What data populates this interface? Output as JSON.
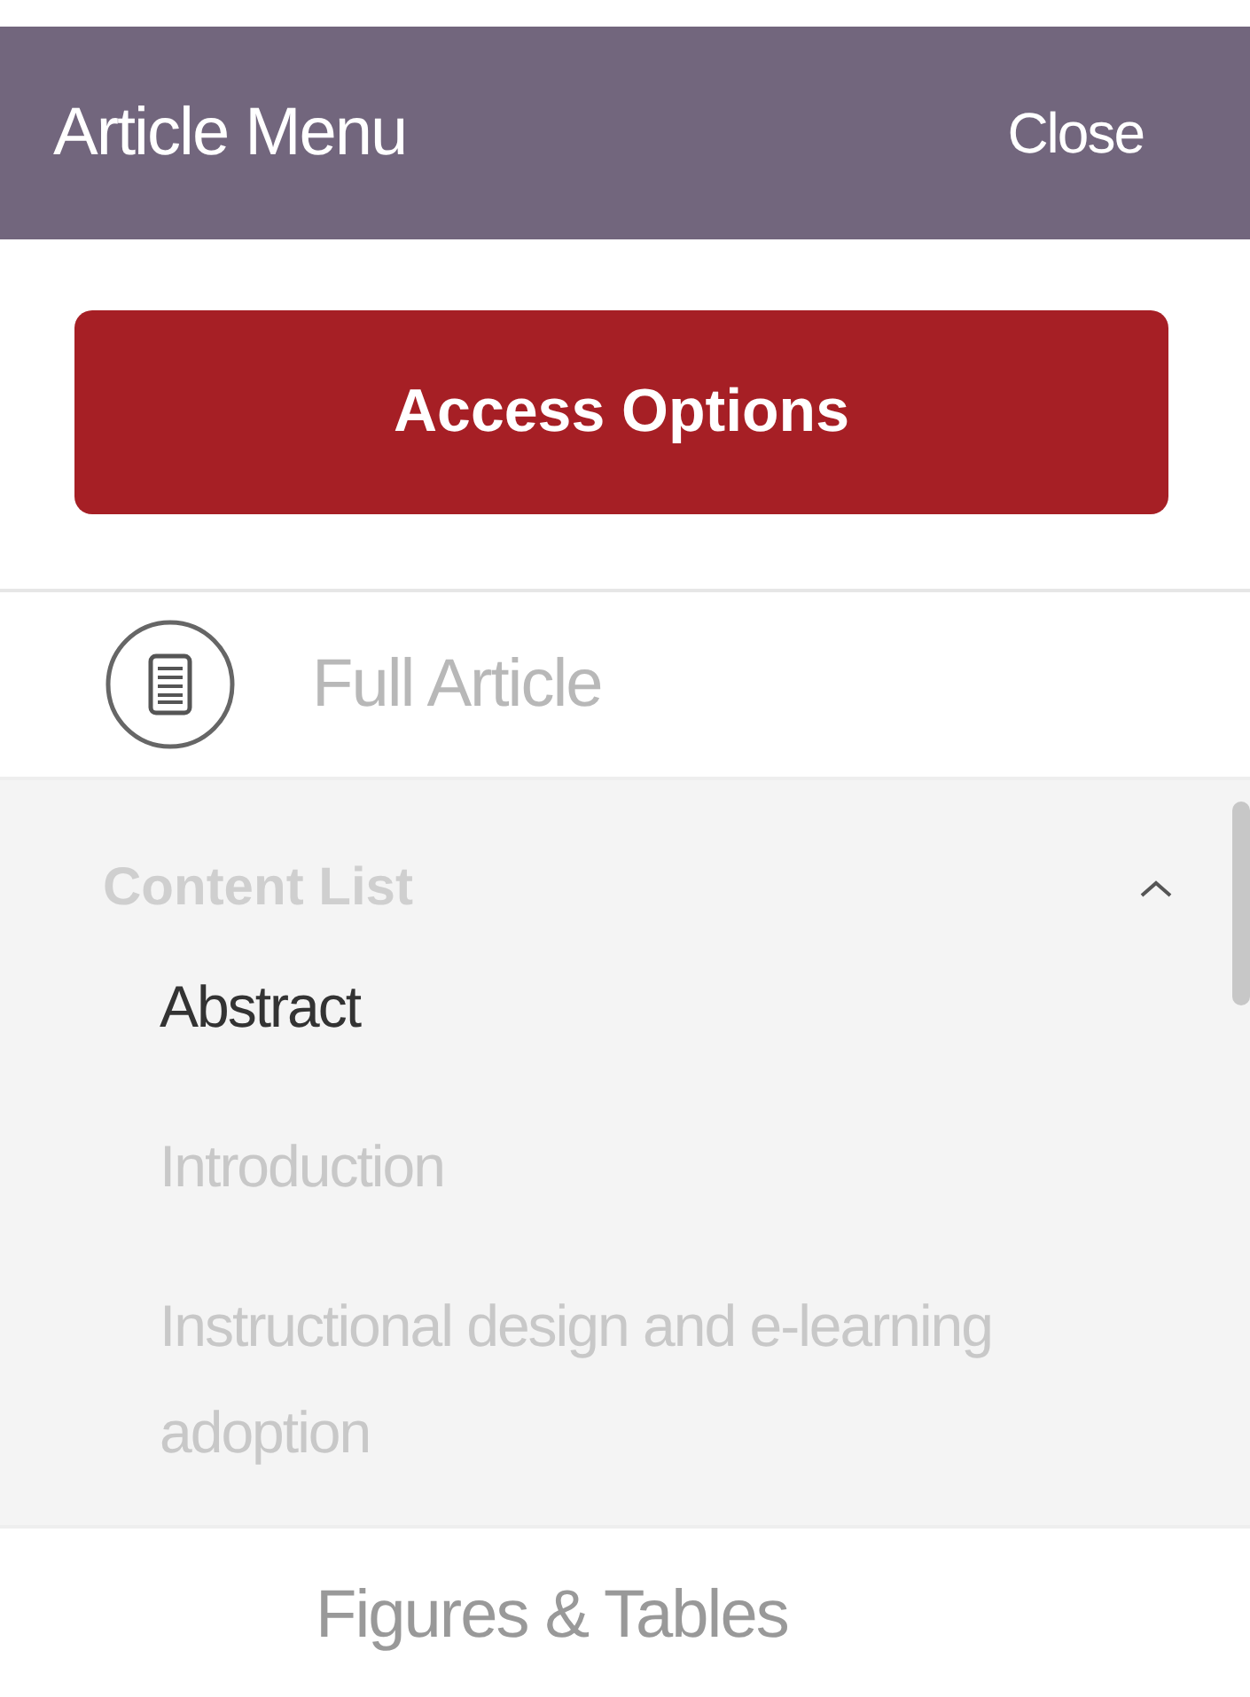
{
  "header": {
    "title": "Article Menu",
    "close": "Close"
  },
  "access_button": "Access Options",
  "full_article": {
    "label": "Full Article"
  },
  "content_list": {
    "title": "Content List",
    "expanded": true,
    "items": [
      {
        "label": "Abstract",
        "selected": true
      },
      {
        "label": "Introduction",
        "selected": false
      },
      {
        "label": "Instructional design and e-learning adoption",
        "selected": false
      }
    ]
  },
  "footer": {
    "label": "Figures & Tables"
  }
}
